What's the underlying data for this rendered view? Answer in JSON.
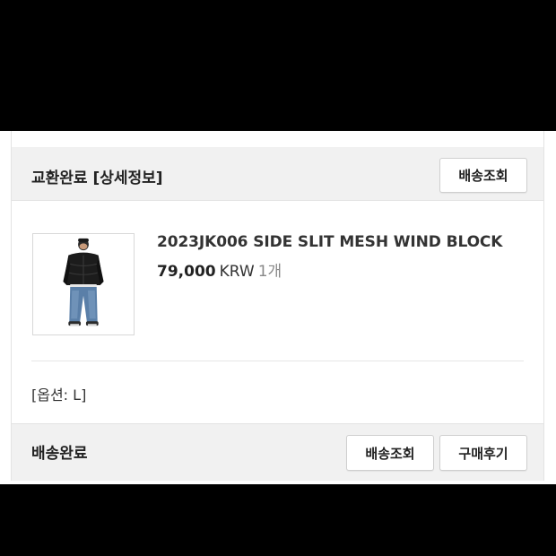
{
  "order": {
    "status_title": "교환완료 [상세정보]",
    "track_button_label": "배송조회"
  },
  "product": {
    "name": "2023JK006 SIDE SLIT MESH WIND BLOCK",
    "price": "79,000",
    "currency": "KRW",
    "quantity": "1개",
    "option": "[옵션: L]",
    "image_icon": "product-photo-person-jacket-jeans"
  },
  "footer": {
    "status_title": "배송완료",
    "track_button_label": "배송조회",
    "review_button_label": "구매후기"
  }
}
